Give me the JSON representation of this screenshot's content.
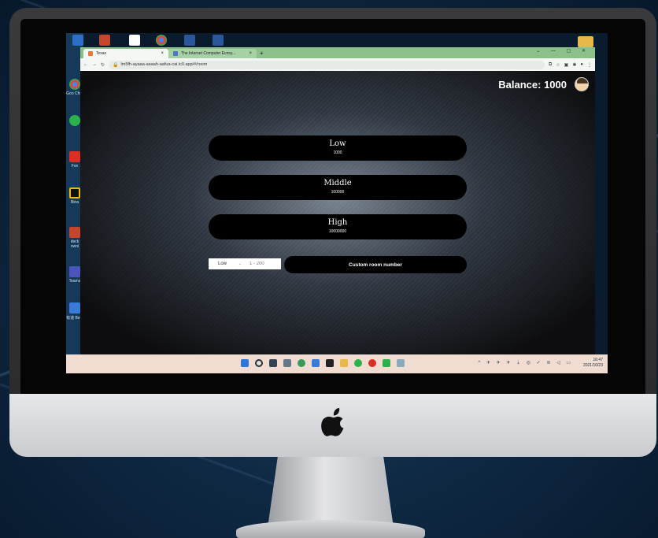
{
  "desktop": {
    "icon_labels": [
      "Goo Chro",
      "Fon",
      "Bina",
      "deck owni",
      "Teams",
      "有道 Beta"
    ]
  },
  "browser": {
    "tabs": [
      {
        "label": "Texas",
        "active": true
      },
      {
        "label": "The Internet Computer Ecosy...",
        "active": false
      }
    ],
    "new_tab_label": "+",
    "window_controls": "⌄ — ▢ ✕",
    "url": "lm5fh-ayaaa-aaaah-aafua-cai.ic0.app/#/room"
  },
  "page": {
    "balance_label": "Balance: 1000",
    "rooms": [
      {
        "name": "Low",
        "amount": "1000"
      },
      {
        "name": "Middle",
        "amount": "100000"
      },
      {
        "name": "High",
        "amount": "10000000"
      }
    ],
    "custom": {
      "select_value": "Low",
      "input_placeholder": "1 - 200",
      "button_label": "Custom room number"
    }
  },
  "taskbar": {
    "time": "16:47",
    "date": "2021/10/23"
  },
  "colors": {
    "tab_bar": "#8bc08a",
    "room_button": "#000000",
    "taskbar": "#f0dcd0"
  }
}
